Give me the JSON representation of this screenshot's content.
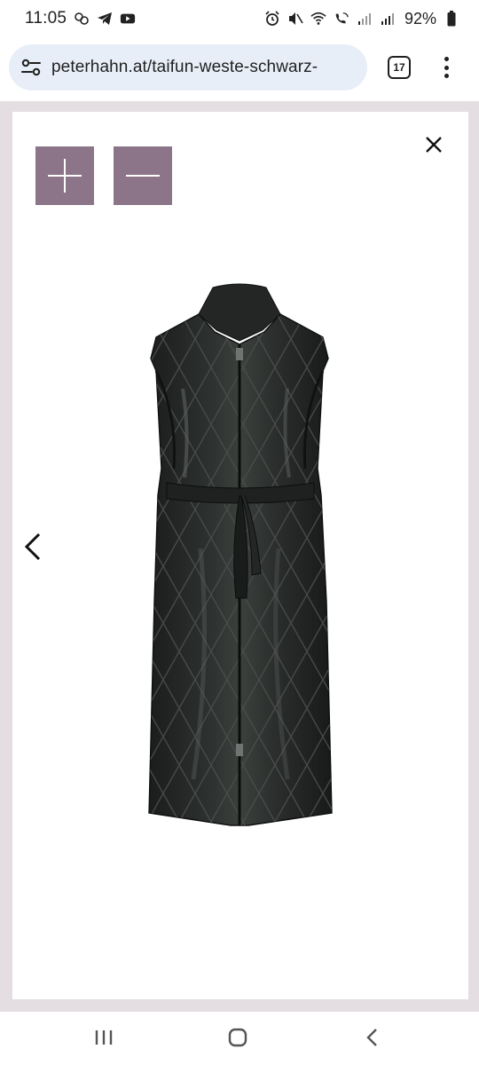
{
  "status_bar": {
    "time": "11:05",
    "battery": "92%"
  },
  "browser": {
    "url": "peterhahn.at/taifun-weste-schwarz-",
    "tab_count": "17"
  },
  "viewer": {
    "zoom_in_icon": "plus-icon",
    "zoom_out_icon": "minus-icon",
    "close_icon": "close-icon",
    "prev_icon": "chevron-left-icon",
    "accent_color": "#8c7489",
    "image": "black quilted long vest with belt"
  },
  "nav_bar": {
    "icons": [
      "recents-icon",
      "home-icon",
      "back-icon"
    ]
  }
}
